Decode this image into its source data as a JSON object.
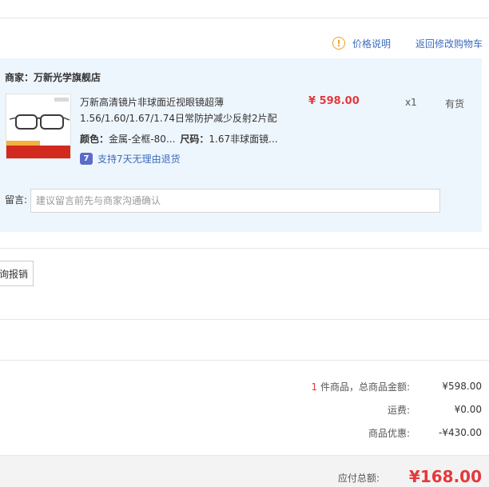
{
  "top_links": {
    "price_note": "价格说明",
    "back_to_cart": "返回修改购物车",
    "warning_icon": "exclamation-circle-icon"
  },
  "shop": {
    "label": "商家：万新光学旗舰店"
  },
  "product": {
    "title_line1": "万新高清镜片非球面近视眼镜超薄",
    "title_line2": "1.56/1.60/1.67/1.74日常防护减少反射2片配",
    "price": "¥ 598.00",
    "quantity": "x1",
    "stock": "有货",
    "color_label": "颜色：",
    "color_value": "金属-全框-80...",
    "size_label": "尺码：",
    "size_value": "1.67非球面镜...",
    "return_icon_text": "7",
    "return_policy": "支持7天无理由退货",
    "image_icon": "eyeglasses-product-thumbnail"
  },
  "note": {
    "label": "留言:",
    "placeholder": "建议留言前先与商家沟通确认"
  },
  "invoice": {
    "button_label": "询报销"
  },
  "summary": {
    "count": "1",
    "count_suffix": " 件商品，总商品金额:",
    "goods_total": "¥598.00",
    "shipping_label": "运费:",
    "shipping_value": "¥0.00",
    "discount_label": "商品优惠:",
    "discount_value": "-¥430.00"
  },
  "total": {
    "label": "应付总额:",
    "value": "¥168.00"
  },
  "colors": {
    "accent_red": "#e4393c",
    "link_blue": "#3d6bbf",
    "shop_bg": "#eef6fd",
    "warning_orange": "#f0a020"
  }
}
